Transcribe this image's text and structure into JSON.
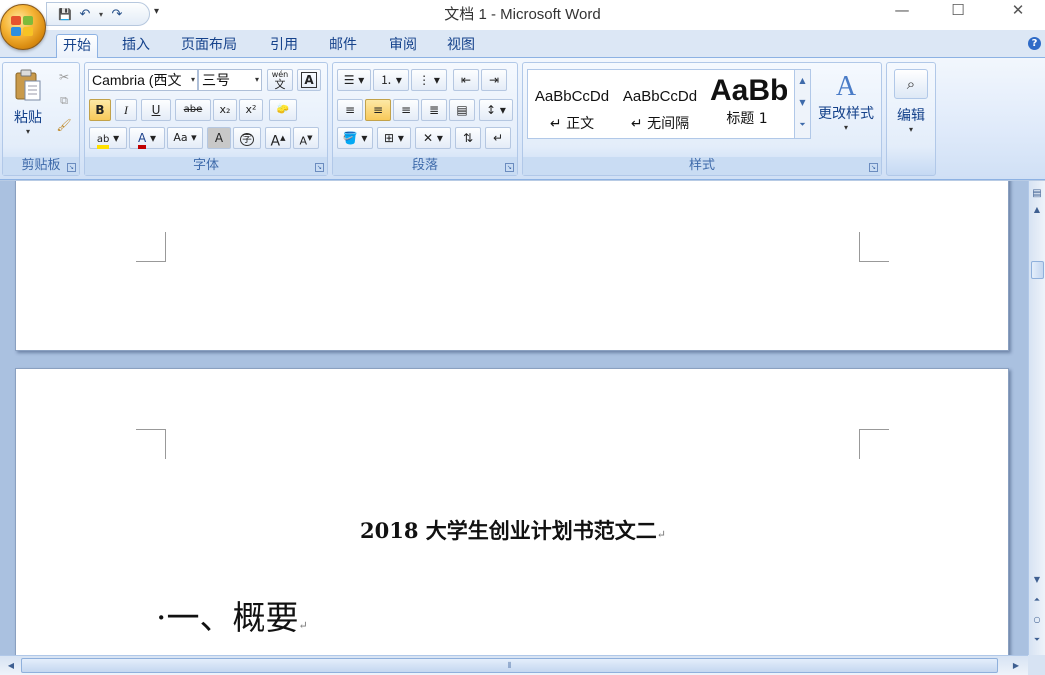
{
  "window": {
    "title": "文档 1 - Microsoft Word",
    "minimize": "—",
    "maximize": "☐",
    "close": "✕"
  },
  "qat": {
    "save": "💾",
    "undo": "↶",
    "redo": "↷",
    "more": "▾"
  },
  "tabs": [
    "开始",
    "插入",
    "页面布局",
    "引用",
    "邮件",
    "审阅",
    "视图"
  ],
  "active_tab": "开始",
  "ribbon": {
    "clipboard": {
      "label": "剪贴板",
      "paste": "粘贴",
      "paste_arrow": "▾"
    },
    "font": {
      "label": "字体",
      "font_name": "Cambria (西文",
      "font_size": "三号",
      "pinyin": "wén",
      "bold": "B",
      "italic": "I",
      "underline": "U",
      "strike": "abe",
      "subscript": "x₂",
      "superscript": "x²",
      "change_case": "Aa",
      "grow": "A",
      "shrink": "A",
      "char_shade": "A",
      "enclose": "字",
      "font_color": "A",
      "highlight": "ab"
    },
    "paragraph": {
      "label": "段落"
    },
    "styles": {
      "label": "样式",
      "items": [
        {
          "sample": "AaBbCcDd",
          "name": "↵ 正文"
        },
        {
          "sample": "AaBbCcDd",
          "name": "↵ 无间隔"
        },
        {
          "sample": "AaBb",
          "name": "标题 1"
        }
      ],
      "change_styles": "更改样式"
    },
    "editing": {
      "label": "编辑"
    }
  },
  "document": {
    "title": "2018 大学生创业计划书范文二",
    "heading": "·一、概要",
    "para_mark": "↵"
  },
  "colors": {
    "ribbon_bg": "#dfeafa",
    "tab_text": "#15428b",
    "group_label": "#3e6aaa",
    "doc_bg": "#aac1e0",
    "highlight_yellow": "#ffe000",
    "font_red": "#c00000"
  }
}
